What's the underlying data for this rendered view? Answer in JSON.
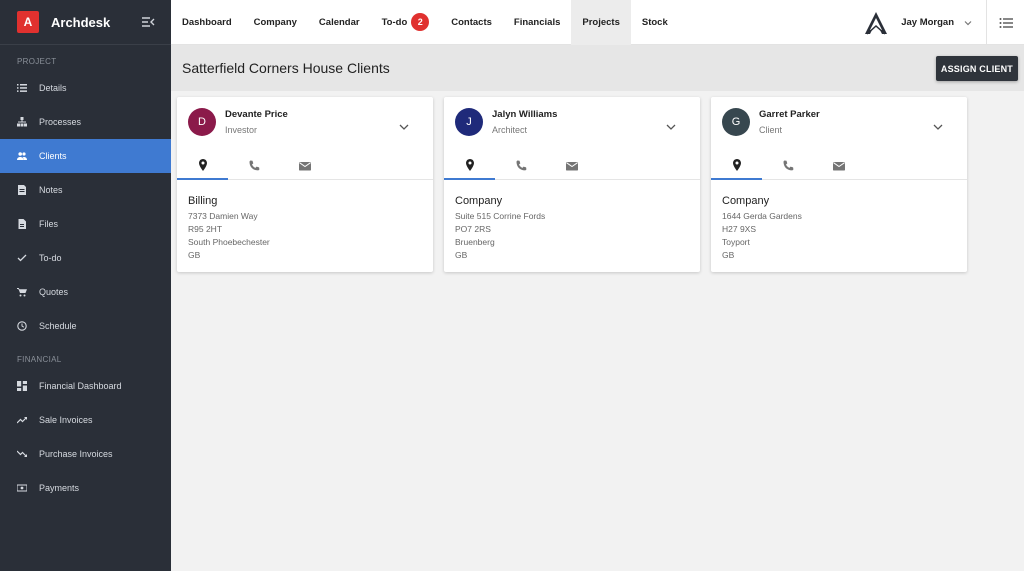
{
  "brand": {
    "logo_letter": "A",
    "name": "Archdesk"
  },
  "sidebar": {
    "sections": [
      {
        "label": "PROJECT",
        "items": [
          {
            "label": "Details",
            "icon": "list-icon"
          },
          {
            "label": "Processes",
            "icon": "hierarchy-icon"
          },
          {
            "label": "Clients",
            "icon": "people-icon",
            "active": true
          },
          {
            "label": "Notes",
            "icon": "note-icon"
          },
          {
            "label": "Files",
            "icon": "file-icon"
          },
          {
            "label": "To-do",
            "icon": "check-icon"
          },
          {
            "label": "Quotes",
            "icon": "cart-icon"
          },
          {
            "label": "Schedule",
            "icon": "clock-icon"
          }
        ]
      },
      {
        "label": "FINANCIAL",
        "items": [
          {
            "label": "Financial Dashboard",
            "icon": "dashboard-icon"
          },
          {
            "label": "Sale Invoices",
            "icon": "trend-up-icon"
          },
          {
            "label": "Purchase Invoices",
            "icon": "trend-down-icon"
          },
          {
            "label": "Payments",
            "icon": "money-icon"
          }
        ]
      }
    ]
  },
  "topnav": {
    "tabs": [
      {
        "label": "Dashboard"
      },
      {
        "label": "Company"
      },
      {
        "label": "Calendar"
      },
      {
        "label": "To-do",
        "badge": "2"
      },
      {
        "label": "Contacts"
      },
      {
        "label": "Financials"
      },
      {
        "label": "Projects",
        "active": true
      },
      {
        "label": "Stock"
      }
    ],
    "user_name": "Jay Morgan"
  },
  "header": {
    "title": "Satterfield Corners House Clients",
    "assign_label": "ASSIGN CLIENT"
  },
  "clients": [
    {
      "initial": "D",
      "name": "Devante Price",
      "role": "Investor",
      "avatar_color": "#8b1a4a",
      "address_type": "Billing",
      "address": [
        "7373 Damien Way",
        "R95 2HT",
        "South Phoebechester",
        "GB"
      ]
    },
    {
      "initial": "J",
      "name": "Jalyn Williams",
      "role": "Architect",
      "avatar_color": "#1f2a7a",
      "address_type": "Company",
      "address": [
        "Suite 515 Corrine Fords",
        "PO7 2RS",
        "Bruenberg",
        "GB"
      ]
    },
    {
      "initial": "G",
      "name": "Garret Parker",
      "role": "Client",
      "avatar_color": "#37474f",
      "address_type": "Company",
      "address": [
        "1644 Gerda Gardens",
        "H27 9XS",
        "Toyport",
        "GB"
      ]
    }
  ],
  "colors": {
    "accent": "#3f7ad1",
    "badge": "#e0312f",
    "sidebar_bg": "#2a2f38"
  }
}
